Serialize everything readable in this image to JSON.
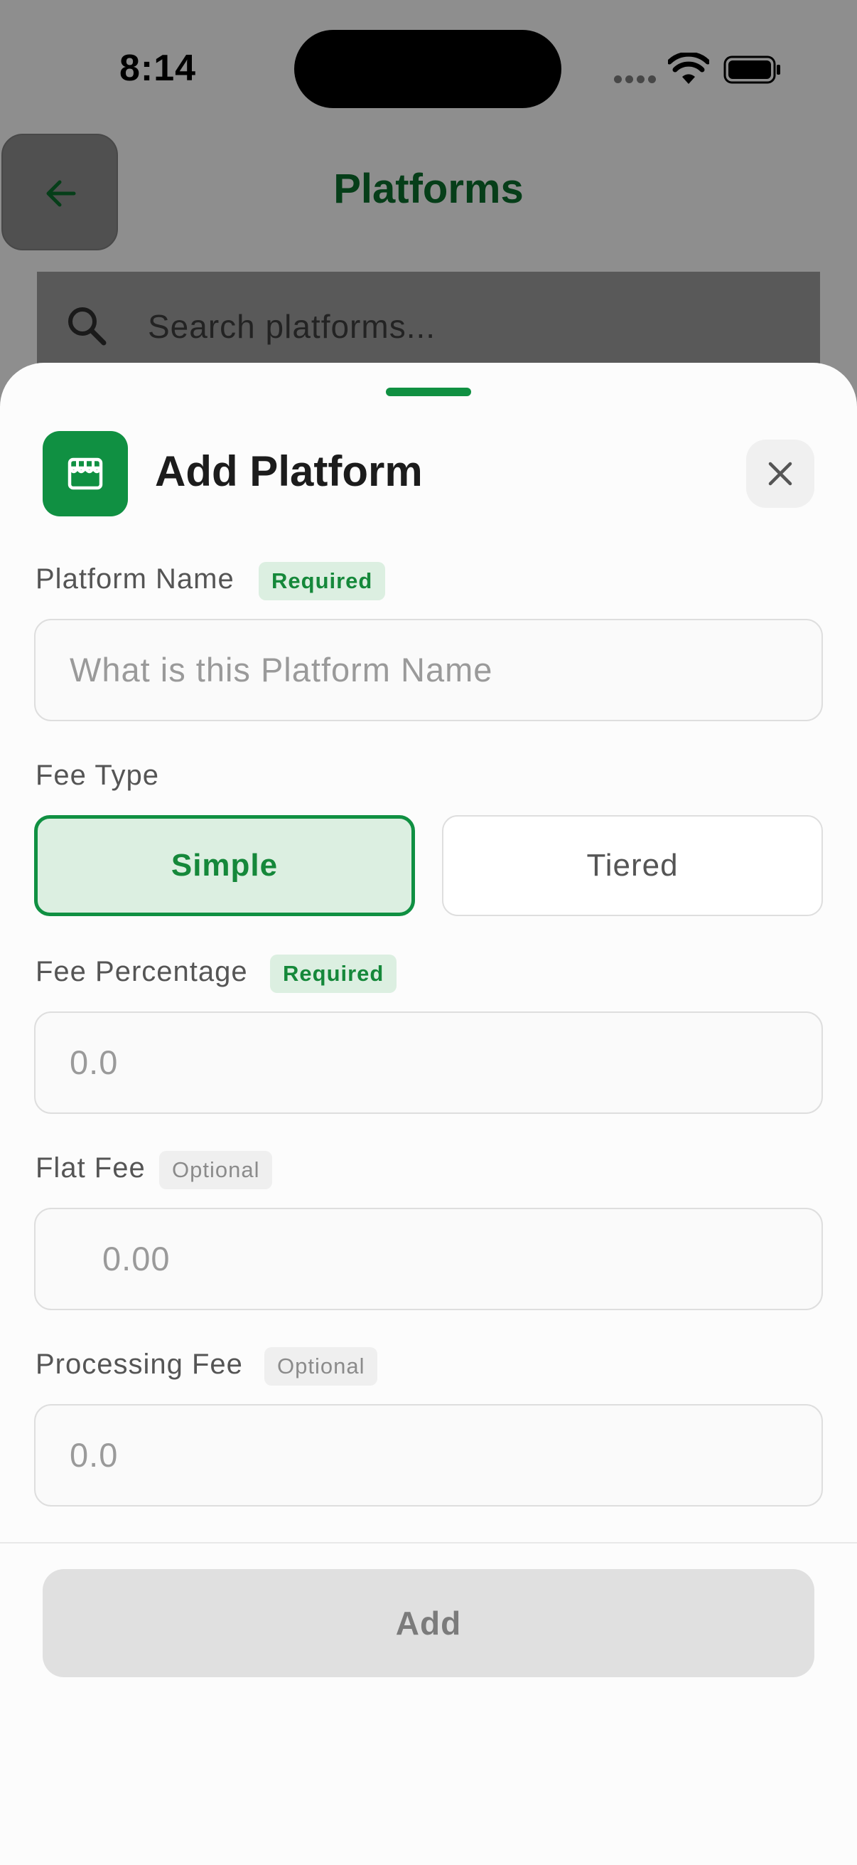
{
  "status_bar": {
    "time": "8:14"
  },
  "background_screen": {
    "title": "Platforms",
    "search": {
      "placeholder": "Search platforms..."
    }
  },
  "sheet": {
    "title": "Add Platform",
    "fields": {
      "platform_name": {
        "label": "Platform Name",
        "badge": "Required",
        "placeholder": "What is this Platform Name"
      },
      "fee_type": {
        "label": "Fee Type",
        "options": [
          "Simple",
          "Tiered"
        ],
        "selected": "Simple"
      },
      "fee_percentage": {
        "label": "Fee Percentage",
        "badge": "Required",
        "placeholder": "0.0"
      },
      "flat_fee": {
        "label": "Flat Fee",
        "badge": "Optional",
        "placeholder": "0.00"
      },
      "processing_fee": {
        "label": "Processing Fee",
        "badge": "Optional",
        "placeholder": "0.0"
      }
    },
    "submit_label": "Add"
  },
  "colors": {
    "accent": "#109042",
    "accent_light": "#dcefe1",
    "title_green": "#0c6b2b"
  }
}
